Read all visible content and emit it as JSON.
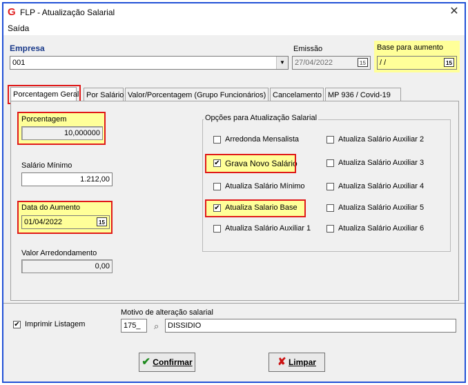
{
  "window": {
    "title": "FLP - Atualização Salarial",
    "logo": "G",
    "close": "✕"
  },
  "menu": {
    "item": "Saída"
  },
  "top": {
    "empresa_label": "Empresa",
    "empresa_value": "001",
    "emissao_label": "Emissão",
    "emissao_value": "27/04/2022",
    "base_label": "Base para aumento",
    "base_value": " / /",
    "cal_icon": "15"
  },
  "tabs": [
    "Porcentagem Geral",
    "Por Salário",
    "Valor/Porcentagem (Grupo Funcionários)",
    "Cancelamento",
    "MP 936 / Covid-19"
  ],
  "left": {
    "porcentagem_label": "Porcentagem",
    "porcentagem_value": "10,000000",
    "salario_minimo_label": "Salário Mínimo",
    "salario_minimo_value": "1.212,00",
    "data_aumento_label": "Data do Aumento",
    "data_aumento_value": "01/04/2022",
    "valor_arred_label": "Valor Arredondamento",
    "valor_arred_value": "0,00"
  },
  "options": {
    "title": "Opções para Atualização Salarial",
    "col1": [
      {
        "label": "Arredonda Mensalista",
        "checked": false
      },
      {
        "label": "Grava Novo Salário",
        "checked": true
      },
      {
        "label": "Atualiza Salário Mínimo",
        "checked": false
      },
      {
        "label": "Atualiza Salario Base",
        "checked": true
      },
      {
        "label": "Atualiza Salário Auxiliar 1",
        "checked": false
      }
    ],
    "col2": [
      {
        "label": "Atualiza Salário Auxiliar 2",
        "checked": false
      },
      {
        "label": "Atualiza Salário Auxiliar 3",
        "checked": false
      },
      {
        "label": "Atualiza Salário Auxiliar 4",
        "checked": false
      },
      {
        "label": "Atualiza Salário Auxiliar 5",
        "checked": false
      },
      {
        "label": "Atualiza Salário Auxiliar 6",
        "checked": false
      }
    ],
    "check_mark": "✔"
  },
  "bottom": {
    "imprimir_label": "Imprimir Listagem",
    "imprimir_checked": true,
    "motivo_label": "Motivo de alteração salarial",
    "motivo_code": "175_",
    "motivo_text": "DISSIDIO",
    "binoculars_glyph": "⌕"
  },
  "buttons": {
    "confirmar_label": "Confirmar",
    "confirmar_icon": "✔",
    "limpar_label": "Limpar",
    "limpar_icon": "✘"
  },
  "colors": {
    "highlight": "#ffff99",
    "annotation": "#e01818",
    "confirm_icon": "#1e8a1e",
    "limpar_icon": "#cc1111",
    "empresa_label": "#1a3a8a"
  }
}
